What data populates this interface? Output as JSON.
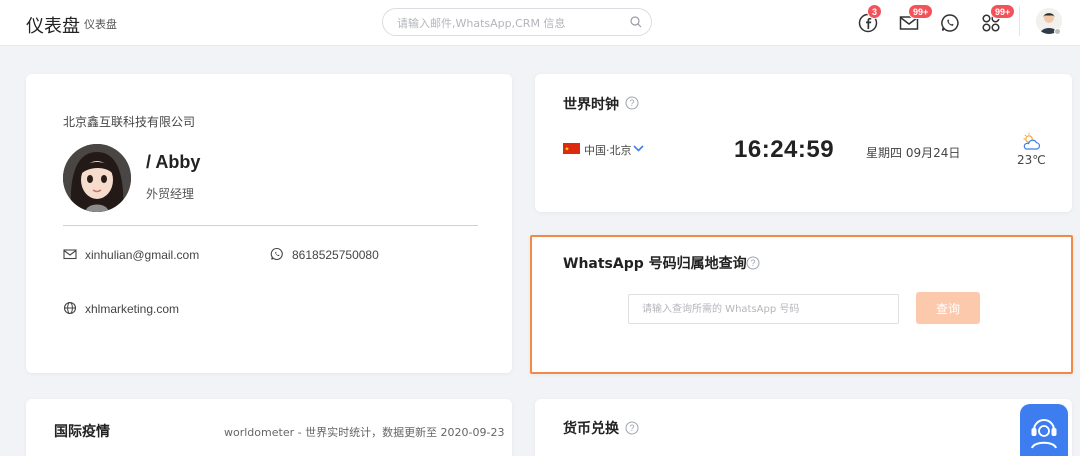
{
  "header": {
    "title": "仪表盘",
    "breadcrumb": "仪表盘",
    "search_placeholder": "请输入邮件,WhatsApp,CRM 信息",
    "icons": [
      {
        "name": "facebook-icon",
        "badge": "3"
      },
      {
        "name": "mail-icon",
        "badge": "99+"
      },
      {
        "name": "whatsapp-icon",
        "badge": ""
      },
      {
        "name": "apps-icon",
        "badge": "99+"
      }
    ]
  },
  "profile": {
    "company": "北京鑫互联科技有限公司",
    "name": "/ Abby",
    "title": "外贸经理",
    "email": "xinhulian@gmail.com",
    "phone": "8618525750080",
    "website": "xhlmarketing.com"
  },
  "world_clock": {
    "title": "世界时钟",
    "region": "中国·北京",
    "time": "16:24:59",
    "date": "星期四 09月24日",
    "temperature": "23℃"
  },
  "whatsapp_lookup": {
    "title": "WhatsApp 号码归属地查询",
    "placeholder": "请输入查询所需的 WhatsApp 号码",
    "button": "查询"
  },
  "covid": {
    "title": "国际疫情",
    "source": "worldometer - 世界实时统计，数据更新至 2020-09-23"
  },
  "fx": {
    "title": "货币兑换"
  },
  "colors": {
    "accent": "#ef8a47",
    "badge": "#f4525b",
    "button_disabled": "#fcc9ac",
    "support": "#3d7df0"
  }
}
